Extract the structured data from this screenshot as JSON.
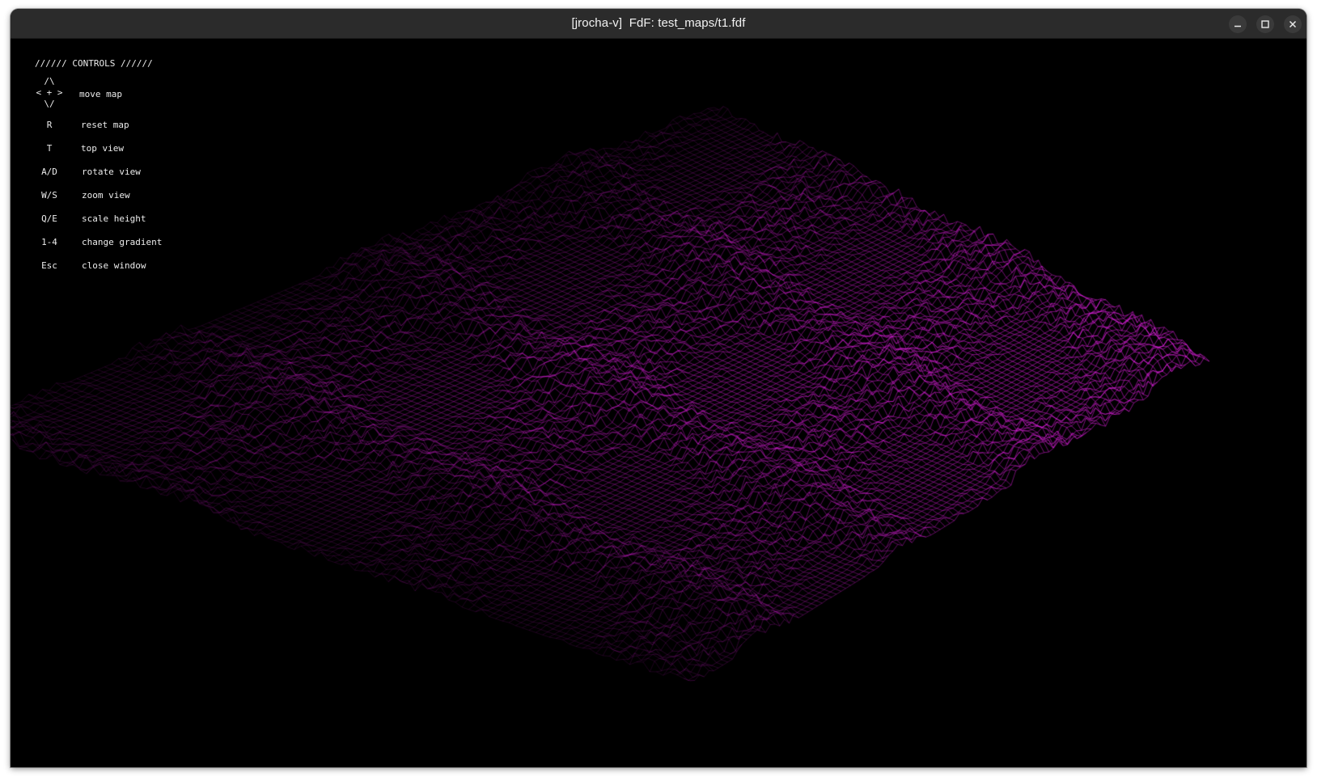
{
  "window": {
    "title": "[jrocha-v]  FdF: test_maps/t1.fdf",
    "buttons": {
      "minimize_icon": "minimize-icon",
      "maximize_icon": "maximize-icon",
      "close_icon": "close-icon"
    }
  },
  "controls": {
    "header": "////// CONTROLS //////",
    "arrows": {
      "up": "/\\",
      "middle": "< + >",
      "down": "\\/"
    },
    "items": [
      {
        "key": "",
        "label": "move map"
      },
      {
        "key": "R",
        "label": "reset map"
      },
      {
        "key": "T",
        "label": "top view"
      },
      {
        "key": "A/D",
        "label": "rotate view"
      },
      {
        "key": "W/S",
        "label": "zoom view"
      },
      {
        "key": "Q/E",
        "label": "scale height"
      },
      {
        "key": "1-4",
        "label": "change gradient"
      },
      {
        "key": "Esc",
        "label": "close window"
      }
    ]
  },
  "render": {
    "line_color": "#e020e0",
    "background_color": "#000000"
  }
}
